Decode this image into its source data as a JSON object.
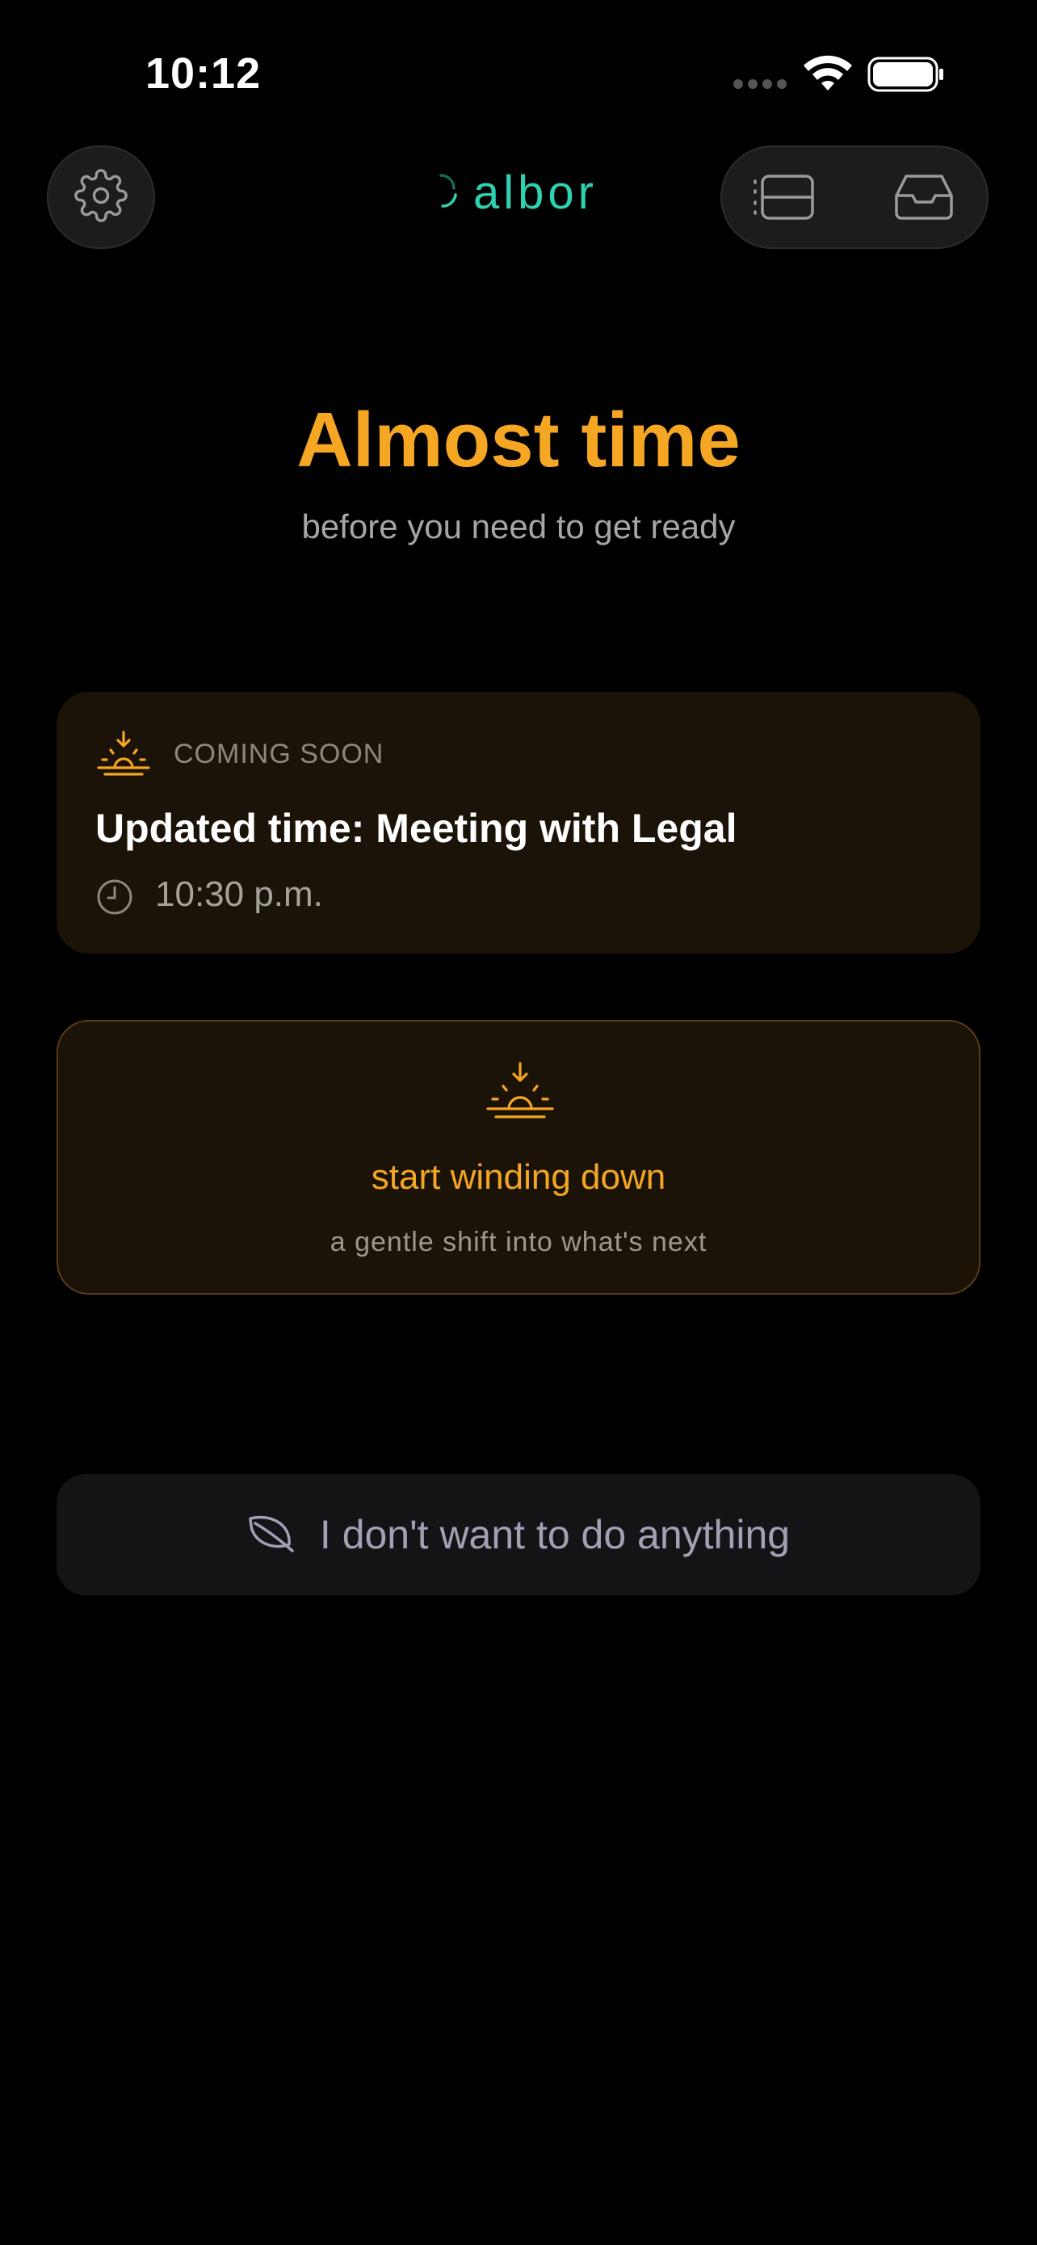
{
  "status_bar": {
    "time": "10:12"
  },
  "header": {
    "app_name": "albor"
  },
  "hero": {
    "title": "Almost time",
    "subtitle": "before you need to get ready"
  },
  "event_card": {
    "kicker": "COMING SOON",
    "title": "Updated time: Meeting with Legal",
    "time": "10:30 p.m."
  },
  "wind_down": {
    "title": "start winding down",
    "subtitle": "a gentle shift into what's next"
  },
  "skip": {
    "label": "I don't want to do anything"
  },
  "colors": {
    "accent": "#f5a623",
    "brand": "#2ed1b0",
    "background": "#000000",
    "card": "#1b1308"
  },
  "icons": [
    "gear-icon",
    "logo-spinner-icon",
    "list-icon",
    "inbox-icon",
    "sunset-icon",
    "clock-icon",
    "leaf-icon"
  ]
}
